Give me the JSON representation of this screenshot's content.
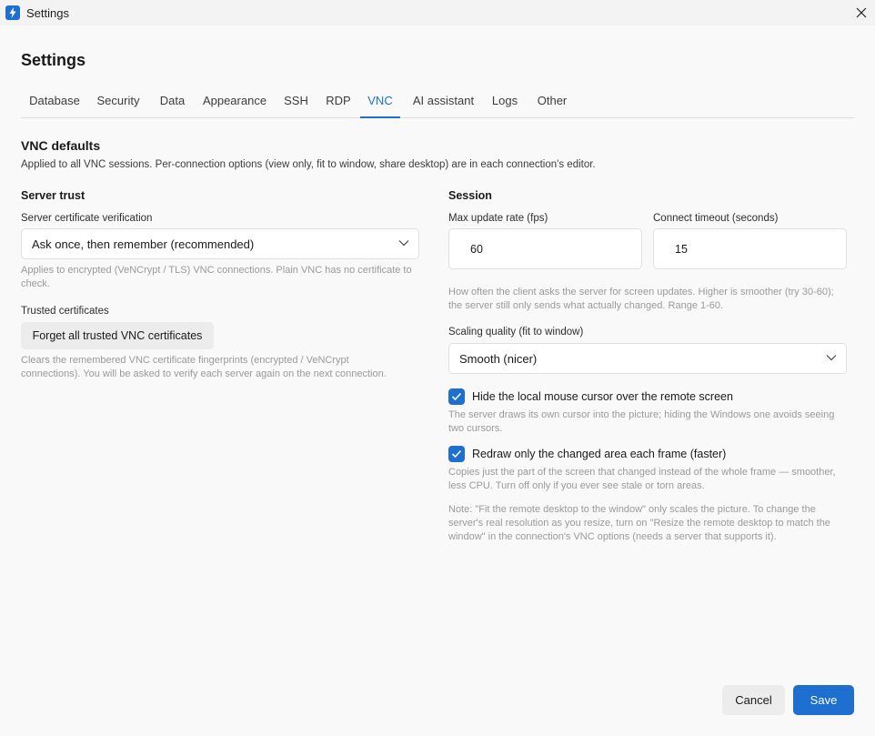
{
  "window": {
    "title": "Settings",
    "app_icon": "lightning-bolt-icon",
    "close_icon": "close-icon"
  },
  "page": {
    "title": "Settings"
  },
  "tabs": [
    {
      "label": "Database"
    },
    {
      "label": "Security"
    },
    {
      "label": "Data"
    },
    {
      "label": "Appearance"
    },
    {
      "label": "SSH"
    },
    {
      "label": "RDP"
    },
    {
      "label": "VNC",
      "active": true
    },
    {
      "label": "AI assistant"
    },
    {
      "label": "Logs"
    },
    {
      "label": "Other"
    }
  ],
  "section": {
    "title": "VNC defaults",
    "description": "Applied to all VNC sessions. Per-connection options (view only, fit to window, share desktop) are in each connection's editor."
  },
  "server_trust": {
    "heading": "Server trust",
    "verification_label": "Server certificate verification",
    "verification_value": "Ask once, then remember (recommended)",
    "verification_hint_1": "Applies to encrypted (VeNCrypt / TLS) VNC connections. Plain VNC has no certificate to",
    "verification_hint_2": "check.",
    "trusted_label": "Trusted certificates",
    "forget_button": "Forget all trusted VNC certificates",
    "forget_hint_1": "Clears the remembered VNC certificate fingerprints (encrypted / VeNCrypt",
    "forget_hint_2": "connections). You will be asked to verify each server again on the next connection."
  },
  "session": {
    "heading": "Session",
    "max_rate_label": "Max update rate (fps)",
    "max_rate_value": "60",
    "timeout_label": "Connect timeout (seconds)",
    "timeout_value": "15",
    "rate_hint_1": "How often the client asks the server for screen updates. Higher is smoother (try 30-60);",
    "rate_hint_2": "the server still only sends what actually changed. Range 1-60.",
    "scaling_label": "Scaling quality (fit to window)",
    "scaling_value": "Smooth (nicer)",
    "hide_cursor_label": "Hide the local mouse cursor over the remote screen",
    "hide_cursor_checked": true,
    "hide_cursor_hint_1": "The server draws its own cursor into the picture; hiding the Windows one avoids seeing",
    "hide_cursor_hint_2": "two cursors.",
    "redraw_label": "Redraw only the changed area each frame (faster)",
    "redraw_checked": true,
    "redraw_hint_1": "Copies just the part of the screen that changed instead of the whole frame — smoother,",
    "redraw_hint_2": "less CPU. Turn off only if you ever see stale or torn areas.",
    "note_1": "Note: \"Fit the remote desktop to the window\" only scales the picture. To change the",
    "note_2": "server's real resolution as you resize, turn on \"Resize the remote desktop to match the",
    "note_3": "window\" in the connection's VNC options (needs a server that supports it)."
  },
  "footer": {
    "cancel_label": "Cancel",
    "save_label": "Save"
  },
  "colors": {
    "accent": "#1f6fd0",
    "hint_text": "#9a9a9a",
    "background": "#f9f9f9"
  }
}
